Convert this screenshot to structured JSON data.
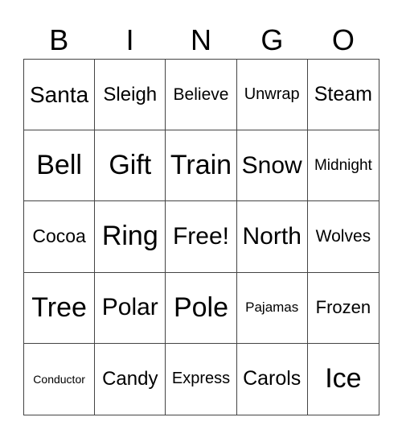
{
  "header": [
    "B",
    "I",
    "N",
    "G",
    "O"
  ],
  "cells": [
    [
      "Santa",
      "Sleigh",
      "Believe",
      "Unwrap",
      "Steam"
    ],
    [
      "Bell",
      "Gift",
      "Train",
      "Snow",
      "Midnight"
    ],
    [
      "Cocoa",
      "Ring",
      "Free!",
      "North",
      "Wolves"
    ],
    [
      "Tree",
      "Polar",
      "Pole",
      "Pajamas",
      "Frozen"
    ],
    [
      "Conductor",
      "Candy",
      "Express",
      "Carols",
      "Ice"
    ]
  ]
}
